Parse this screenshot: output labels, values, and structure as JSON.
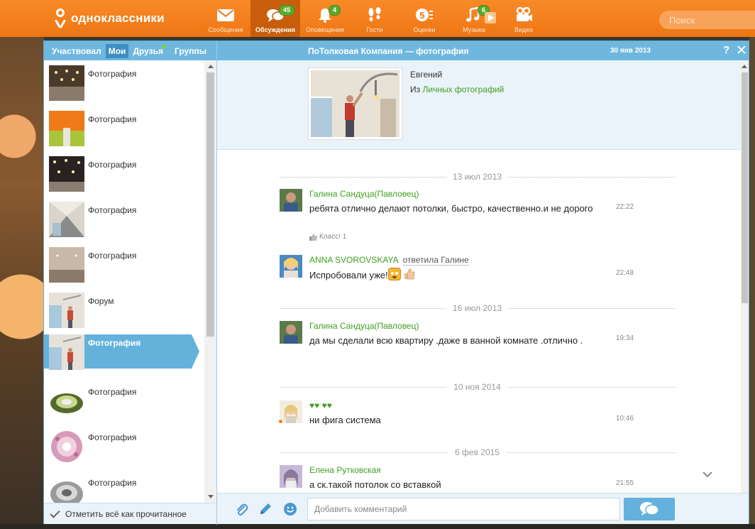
{
  "brand": {
    "name": "одноклассники"
  },
  "nav": [
    {
      "label": "Сообщения",
      "icon": "envelope-icon",
      "badge": ""
    },
    {
      "label": "Обсуждения",
      "icon": "discussions-icon",
      "badge": "45",
      "active": true
    },
    {
      "label": "Оповещения",
      "icon": "bell-icon",
      "badge": "4"
    },
    {
      "label": "Гости",
      "icon": "footprints-icon",
      "badge": ""
    },
    {
      "label": "Оценки",
      "icon": "rating-5-icon",
      "badge": ""
    },
    {
      "label": "Музыка",
      "icon": "music-note-icon",
      "badge": "6"
    },
    {
      "label": "Видео",
      "icon": "video-camera-icon",
      "badge": ""
    }
  ],
  "search": {
    "placeholder": "Поиск"
  },
  "dialog": {
    "tabs": [
      "Участвовал",
      "Мои",
      "Друзья",
      "Группы"
    ],
    "active_tab": "Мои",
    "title": "ПоТолковая Компания — фотография",
    "date": "30 янв 2013",
    "help": "?",
    "close": "✕"
  },
  "list": {
    "items": [
      {
        "label": "Фотография",
        "thumb": "ceiling-lights-photo"
      },
      {
        "label": "Фотография",
        "thumb": "orange-green-ceiling-photo"
      },
      {
        "label": "Фотография",
        "thumb": "spotlights-photo"
      },
      {
        "label": "Фотография",
        "thumb": "room-ceiling-photo"
      },
      {
        "label": "Фотография",
        "thumb": "beige-ceiling-photo"
      },
      {
        "label": "Форум",
        "thumb": "worker-photo"
      },
      {
        "label": "Фотография",
        "thumb": "worker-photo",
        "selected": true
      },
      {
        "label": "Фотография",
        "thumb": "green-fixture-photo"
      },
      {
        "label": "Фотография",
        "thumb": "pink-crystal-fixture-photo"
      },
      {
        "label": "Фотография",
        "thumb": "silver-fixture-photo"
      }
    ],
    "mark_all_read": "Отметить всё как прочитанное"
  },
  "topic": {
    "author": "Евгений",
    "source_prefix": "Из",
    "source_link": "Личных фотографий"
  },
  "messages": [
    {
      "type": "date",
      "text": "13 июл 2013"
    },
    {
      "type": "msg",
      "author": "Галина Сандуца(Павловец)",
      "text": "ребята отлично делают потолки, быстро, качественно.и не дорого",
      "time": "22:22",
      "like": "Класс! 1"
    },
    {
      "type": "msg",
      "author": "ANNA SVOROVSKAYA",
      "reply": "ответила Галине",
      "text": "Испробовали уже!",
      "time": "22:48"
    },
    {
      "type": "date",
      "text": "16 июл 2013"
    },
    {
      "type": "msg",
      "author": "Галина Сандуца(Павловец)",
      "text": "да мы сделали всю квартиру .даже в ванной комнате .отлично .",
      "time": "19:34"
    },
    {
      "type": "date",
      "text": "10 ноя 2014"
    },
    {
      "type": "msg",
      "author": "♥♥ ♥♥",
      "text": "ни фига система",
      "time": "10:46"
    },
    {
      "type": "date",
      "text": "6 фев 2015"
    },
    {
      "type": "msg",
      "author": "Елена Рутковская",
      "text": "а ск.такой потолок со вставкой",
      "time": "21:55"
    }
  ],
  "composer": {
    "placeholder": "Добавить комментарий"
  }
}
